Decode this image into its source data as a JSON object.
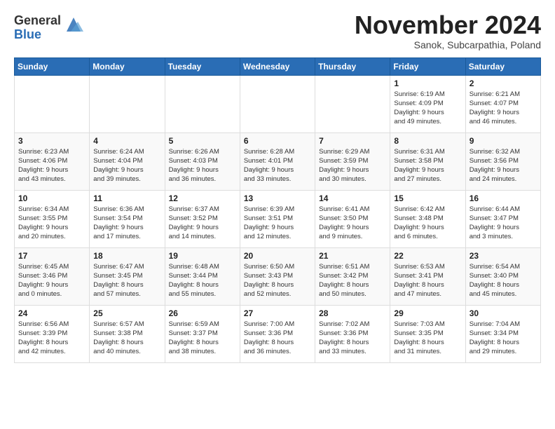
{
  "logo": {
    "general": "General",
    "blue": "Blue"
  },
  "header": {
    "month": "November 2024",
    "location": "Sanok, Subcarpathia, Poland"
  },
  "days_of_week": [
    "Sunday",
    "Monday",
    "Tuesday",
    "Wednesday",
    "Thursday",
    "Friday",
    "Saturday"
  ],
  "weeks": [
    [
      {
        "day": "",
        "info": ""
      },
      {
        "day": "",
        "info": ""
      },
      {
        "day": "",
        "info": ""
      },
      {
        "day": "",
        "info": ""
      },
      {
        "day": "",
        "info": ""
      },
      {
        "day": "1",
        "info": "Sunrise: 6:19 AM\nSunset: 4:09 PM\nDaylight: 9 hours\nand 49 minutes."
      },
      {
        "day": "2",
        "info": "Sunrise: 6:21 AM\nSunset: 4:07 PM\nDaylight: 9 hours\nand 46 minutes."
      }
    ],
    [
      {
        "day": "3",
        "info": "Sunrise: 6:23 AM\nSunset: 4:06 PM\nDaylight: 9 hours\nand 43 minutes."
      },
      {
        "day": "4",
        "info": "Sunrise: 6:24 AM\nSunset: 4:04 PM\nDaylight: 9 hours\nand 39 minutes."
      },
      {
        "day": "5",
        "info": "Sunrise: 6:26 AM\nSunset: 4:03 PM\nDaylight: 9 hours\nand 36 minutes."
      },
      {
        "day": "6",
        "info": "Sunrise: 6:28 AM\nSunset: 4:01 PM\nDaylight: 9 hours\nand 33 minutes."
      },
      {
        "day": "7",
        "info": "Sunrise: 6:29 AM\nSunset: 3:59 PM\nDaylight: 9 hours\nand 30 minutes."
      },
      {
        "day": "8",
        "info": "Sunrise: 6:31 AM\nSunset: 3:58 PM\nDaylight: 9 hours\nand 27 minutes."
      },
      {
        "day": "9",
        "info": "Sunrise: 6:32 AM\nSunset: 3:56 PM\nDaylight: 9 hours\nand 24 minutes."
      }
    ],
    [
      {
        "day": "10",
        "info": "Sunrise: 6:34 AM\nSunset: 3:55 PM\nDaylight: 9 hours\nand 20 minutes."
      },
      {
        "day": "11",
        "info": "Sunrise: 6:36 AM\nSunset: 3:54 PM\nDaylight: 9 hours\nand 17 minutes."
      },
      {
        "day": "12",
        "info": "Sunrise: 6:37 AM\nSunset: 3:52 PM\nDaylight: 9 hours\nand 14 minutes."
      },
      {
        "day": "13",
        "info": "Sunrise: 6:39 AM\nSunset: 3:51 PM\nDaylight: 9 hours\nand 12 minutes."
      },
      {
        "day": "14",
        "info": "Sunrise: 6:41 AM\nSunset: 3:50 PM\nDaylight: 9 hours\nand 9 minutes."
      },
      {
        "day": "15",
        "info": "Sunrise: 6:42 AM\nSunset: 3:48 PM\nDaylight: 9 hours\nand 6 minutes."
      },
      {
        "day": "16",
        "info": "Sunrise: 6:44 AM\nSunset: 3:47 PM\nDaylight: 9 hours\nand 3 minutes."
      }
    ],
    [
      {
        "day": "17",
        "info": "Sunrise: 6:45 AM\nSunset: 3:46 PM\nDaylight: 9 hours\nand 0 minutes."
      },
      {
        "day": "18",
        "info": "Sunrise: 6:47 AM\nSunset: 3:45 PM\nDaylight: 8 hours\nand 57 minutes."
      },
      {
        "day": "19",
        "info": "Sunrise: 6:48 AM\nSunset: 3:44 PM\nDaylight: 8 hours\nand 55 minutes."
      },
      {
        "day": "20",
        "info": "Sunrise: 6:50 AM\nSunset: 3:43 PM\nDaylight: 8 hours\nand 52 minutes."
      },
      {
        "day": "21",
        "info": "Sunrise: 6:51 AM\nSunset: 3:42 PM\nDaylight: 8 hours\nand 50 minutes."
      },
      {
        "day": "22",
        "info": "Sunrise: 6:53 AM\nSunset: 3:41 PM\nDaylight: 8 hours\nand 47 minutes."
      },
      {
        "day": "23",
        "info": "Sunrise: 6:54 AM\nSunset: 3:40 PM\nDaylight: 8 hours\nand 45 minutes."
      }
    ],
    [
      {
        "day": "24",
        "info": "Sunrise: 6:56 AM\nSunset: 3:39 PM\nDaylight: 8 hours\nand 42 minutes."
      },
      {
        "day": "25",
        "info": "Sunrise: 6:57 AM\nSunset: 3:38 PM\nDaylight: 8 hours\nand 40 minutes."
      },
      {
        "day": "26",
        "info": "Sunrise: 6:59 AM\nSunset: 3:37 PM\nDaylight: 8 hours\nand 38 minutes."
      },
      {
        "day": "27",
        "info": "Sunrise: 7:00 AM\nSunset: 3:36 PM\nDaylight: 8 hours\nand 36 minutes."
      },
      {
        "day": "28",
        "info": "Sunrise: 7:02 AM\nSunset: 3:36 PM\nDaylight: 8 hours\nand 33 minutes."
      },
      {
        "day": "29",
        "info": "Sunrise: 7:03 AM\nSunset: 3:35 PM\nDaylight: 8 hours\nand 31 minutes."
      },
      {
        "day": "30",
        "info": "Sunrise: 7:04 AM\nSunset: 3:34 PM\nDaylight: 8 hours\nand 29 minutes."
      }
    ]
  ]
}
